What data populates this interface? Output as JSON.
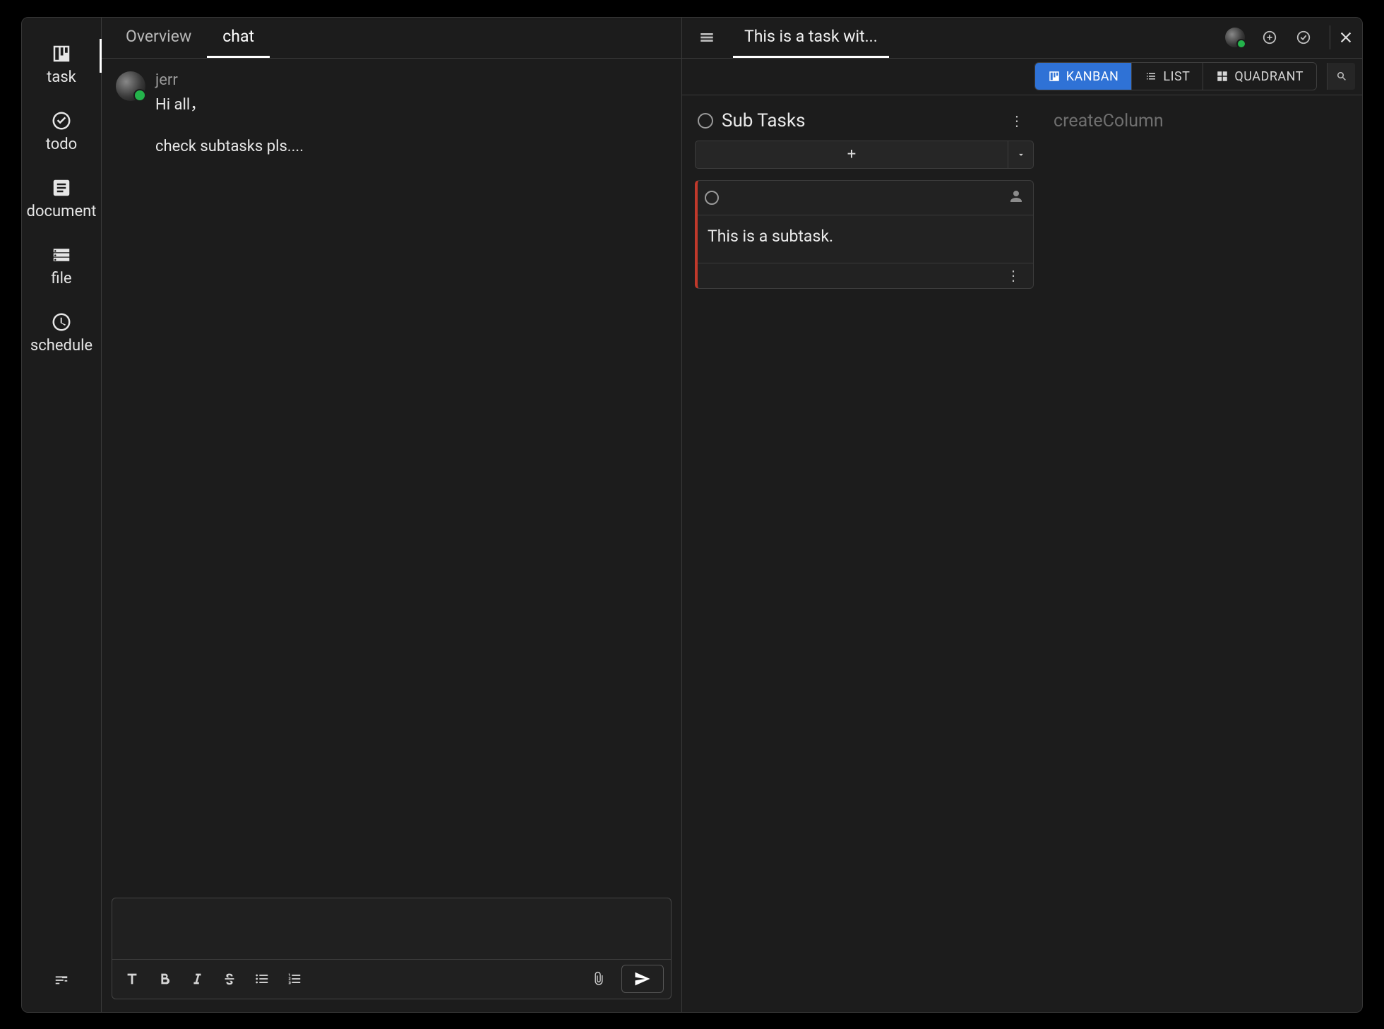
{
  "sidebar": {
    "items": [
      {
        "label": "task"
      },
      {
        "label": "todo"
      },
      {
        "label": "document"
      },
      {
        "label": "file"
      },
      {
        "label": "schedule"
      }
    ]
  },
  "leftPane": {
    "tabs": [
      {
        "label": "Overview",
        "active": false
      },
      {
        "label": "chat",
        "active": true
      }
    ],
    "message": {
      "user": "jerr",
      "line1": "Hi all，",
      "line2": "check subtasks pls...."
    }
  },
  "rightPane": {
    "title": "This is a task wit...",
    "views": {
      "kanban": "KANBAN",
      "list": "LIST",
      "quadrant": "QUADRANT"
    },
    "column": {
      "title": "Sub Tasks"
    },
    "card": {
      "text": "This is a subtask."
    },
    "createColumn": "createColumn"
  }
}
